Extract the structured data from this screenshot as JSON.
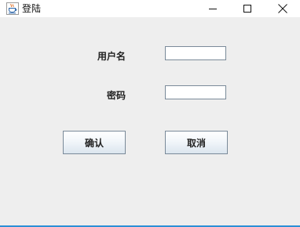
{
  "window": {
    "title": "登陆",
    "icon": "java-coffee-cup-icon",
    "controls": {
      "minimize_icon": "minimize-icon",
      "maximize_icon": "maximize-icon",
      "close_icon": "close-icon"
    }
  },
  "form": {
    "username_label": "用户名",
    "username_value": "",
    "password_label": "密码",
    "password_value": ""
  },
  "buttons": {
    "confirm_label": "确认",
    "cancel_label": "取消"
  },
  "colors": {
    "window_background": "#eeeeee",
    "titlebar_background": "#ffffff",
    "field_border": "#7a8a99",
    "bottom_border": "#2b8fd6"
  }
}
